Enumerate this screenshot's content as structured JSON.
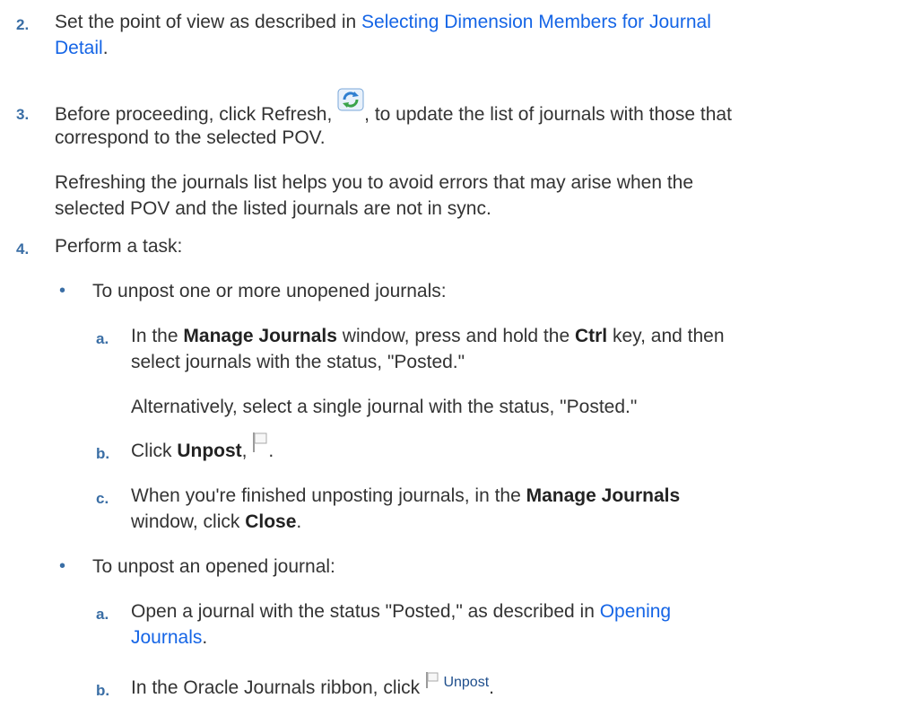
{
  "steps": {
    "s2": {
      "num": "2.",
      "pre": "Set the point of view as described in ",
      "link1": "Selecting Dimension Members for Journal",
      "link2": "Detail",
      "post": "."
    },
    "s3": {
      "num": "3.",
      "pre": "Before proceeding, click Refresh, ",
      "post": ", to update the list of journals with those that",
      "line2": "correspond to the selected POV.",
      "note_line1": "Refreshing the journals list helps you to avoid errors that may arise when the",
      "note_line2": "selected POV and the listed journals are not in sync."
    },
    "s4": {
      "num": "4.",
      "text": "Perform a task:"
    }
  },
  "bullet1": {
    "mark": "•",
    "text": "To unpost one or more unopened journals:",
    "a": {
      "label": "a.",
      "p1": "In the ",
      "b1": "Manage Journals",
      "p2": " window, press and hold the ",
      "b2": "Ctrl",
      "p3": " key, and then",
      "line2": "select journals with the status, \"Posted.\"",
      "alt": "Alternatively, select a single journal with the status, \"Posted.\""
    },
    "b": {
      "label": "b.",
      "p1": "Click ",
      "b1": "Unpost",
      "p2": ", ",
      "p3": "."
    },
    "c": {
      "label": "c.",
      "p1": "When you're finished unposting journals, in the ",
      "b1": "Manage Journals",
      "p2": "window, click ",
      "b2": "Close",
      "p3": "."
    }
  },
  "bullet2": {
    "mark": "•",
    "text": "To unpost an opened journal:",
    "a": {
      "label": "a.",
      "p1": "Open a journal with the status \"Posted,\" as described in ",
      "link1": "Opening",
      "link2": "Journals",
      "post": "."
    },
    "b": {
      "label": "b.",
      "p1": "In the Oracle Journals ribbon, click ",
      "button": "Unpost",
      "post": "."
    }
  },
  "icons": {
    "refresh": "refresh-icon",
    "unpost": "unpost-flag-icon"
  },
  "colors": {
    "link": "#1565e6",
    "number": "#3a6ea5",
    "text": "#333333"
  }
}
